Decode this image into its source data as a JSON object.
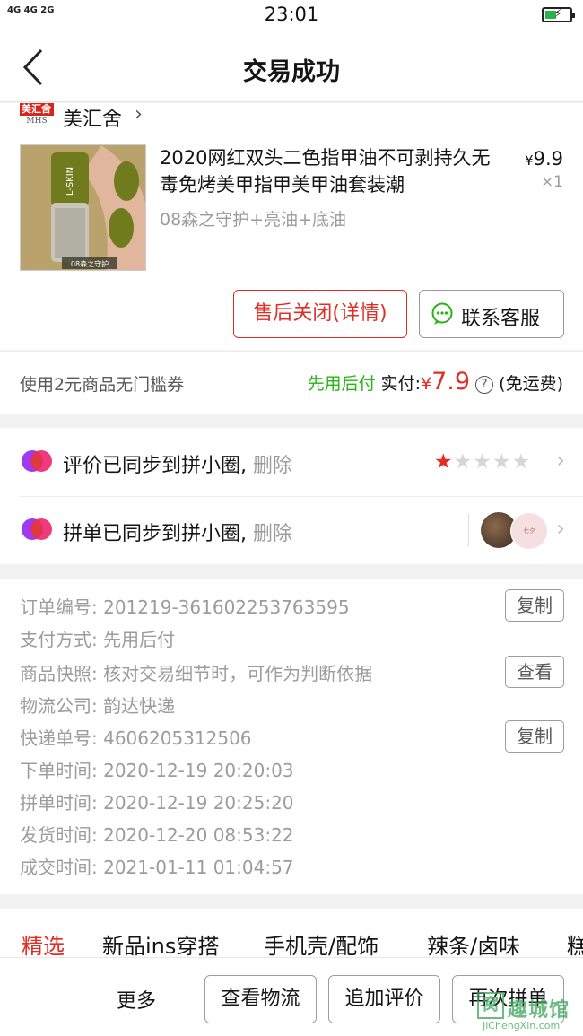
{
  "status_bar": {
    "network": "4G 4G 2G",
    "time": "23:01"
  },
  "nav": {
    "title": "交易成功"
  },
  "shop": {
    "logo_top": "美汇舍",
    "logo_bottom": "MHS",
    "name": "美汇舍"
  },
  "product": {
    "title": "2020网红双头二色指甲油不可剥持久无毒免烤美甲指甲美甲油套装潮",
    "spec": "08森之守护+亮油+底油",
    "price_symbol": "¥",
    "price": "9.9",
    "qty": "×1",
    "image_label_brand": "L-SKIN",
    "image_label_shade": "08森之守护"
  },
  "actions": {
    "aftersale_label": "售后关闭(详情)",
    "service_label": "联系客服"
  },
  "payment": {
    "coupon": "使用2元商品无门槛券",
    "pay_method_tag": "先用后付",
    "paid_label": "实付:",
    "currency": "¥",
    "paid_amount": "7.9",
    "help_glyph": "?",
    "shipping_note": "(免运费)"
  },
  "sync": {
    "review_label": "评价已同步到拼小圈,",
    "review_delete": "删除",
    "rating": 1,
    "rating_max": 5,
    "group_label": "拼单已同步到拼小圈,",
    "group_delete": "删除",
    "avatar2_text": "七夕"
  },
  "details": {
    "order_no_key": "订单编号:",
    "order_no": "201219-361602253763595",
    "pay_key": "支付方式:",
    "pay": "先用后付",
    "snapshot_key": "商品快照:",
    "snapshot": "核对交易细节时，可作为判断依据",
    "logistics_key": "物流公司:",
    "logistics": "韵达快递",
    "tracking_key": "快递单号:",
    "tracking": "4606205312506",
    "placed_key": "下单时间:",
    "placed": "2020-12-19 20:20:03",
    "grouped_key": "拼单时间:",
    "grouped": "2020-12-19 20:25:20",
    "shipped_key": "发货时间:",
    "shipped": "2020-12-20 08:53:22",
    "done_key": "成交时间:",
    "done": "2021-01-11 01:04:57",
    "copy_label": "复制",
    "view_label": "查看"
  },
  "tabs": [
    "精选",
    "新品ins穿搭",
    "手机壳/配饰",
    "辣条/卤味",
    "糕"
  ],
  "bottom": {
    "more": "更多",
    "logistics_btn": "查看物流",
    "add_review_btn": "追加评价",
    "regroup_btn": "再次拼单"
  },
  "watermark": {
    "box": "窝",
    "cn": "趣城馆",
    "en": "JiChengXin.com"
  },
  "colors": {
    "accent_red": "#e02e24",
    "green": "#25b513",
    "muted": "#9c9c9c"
  }
}
